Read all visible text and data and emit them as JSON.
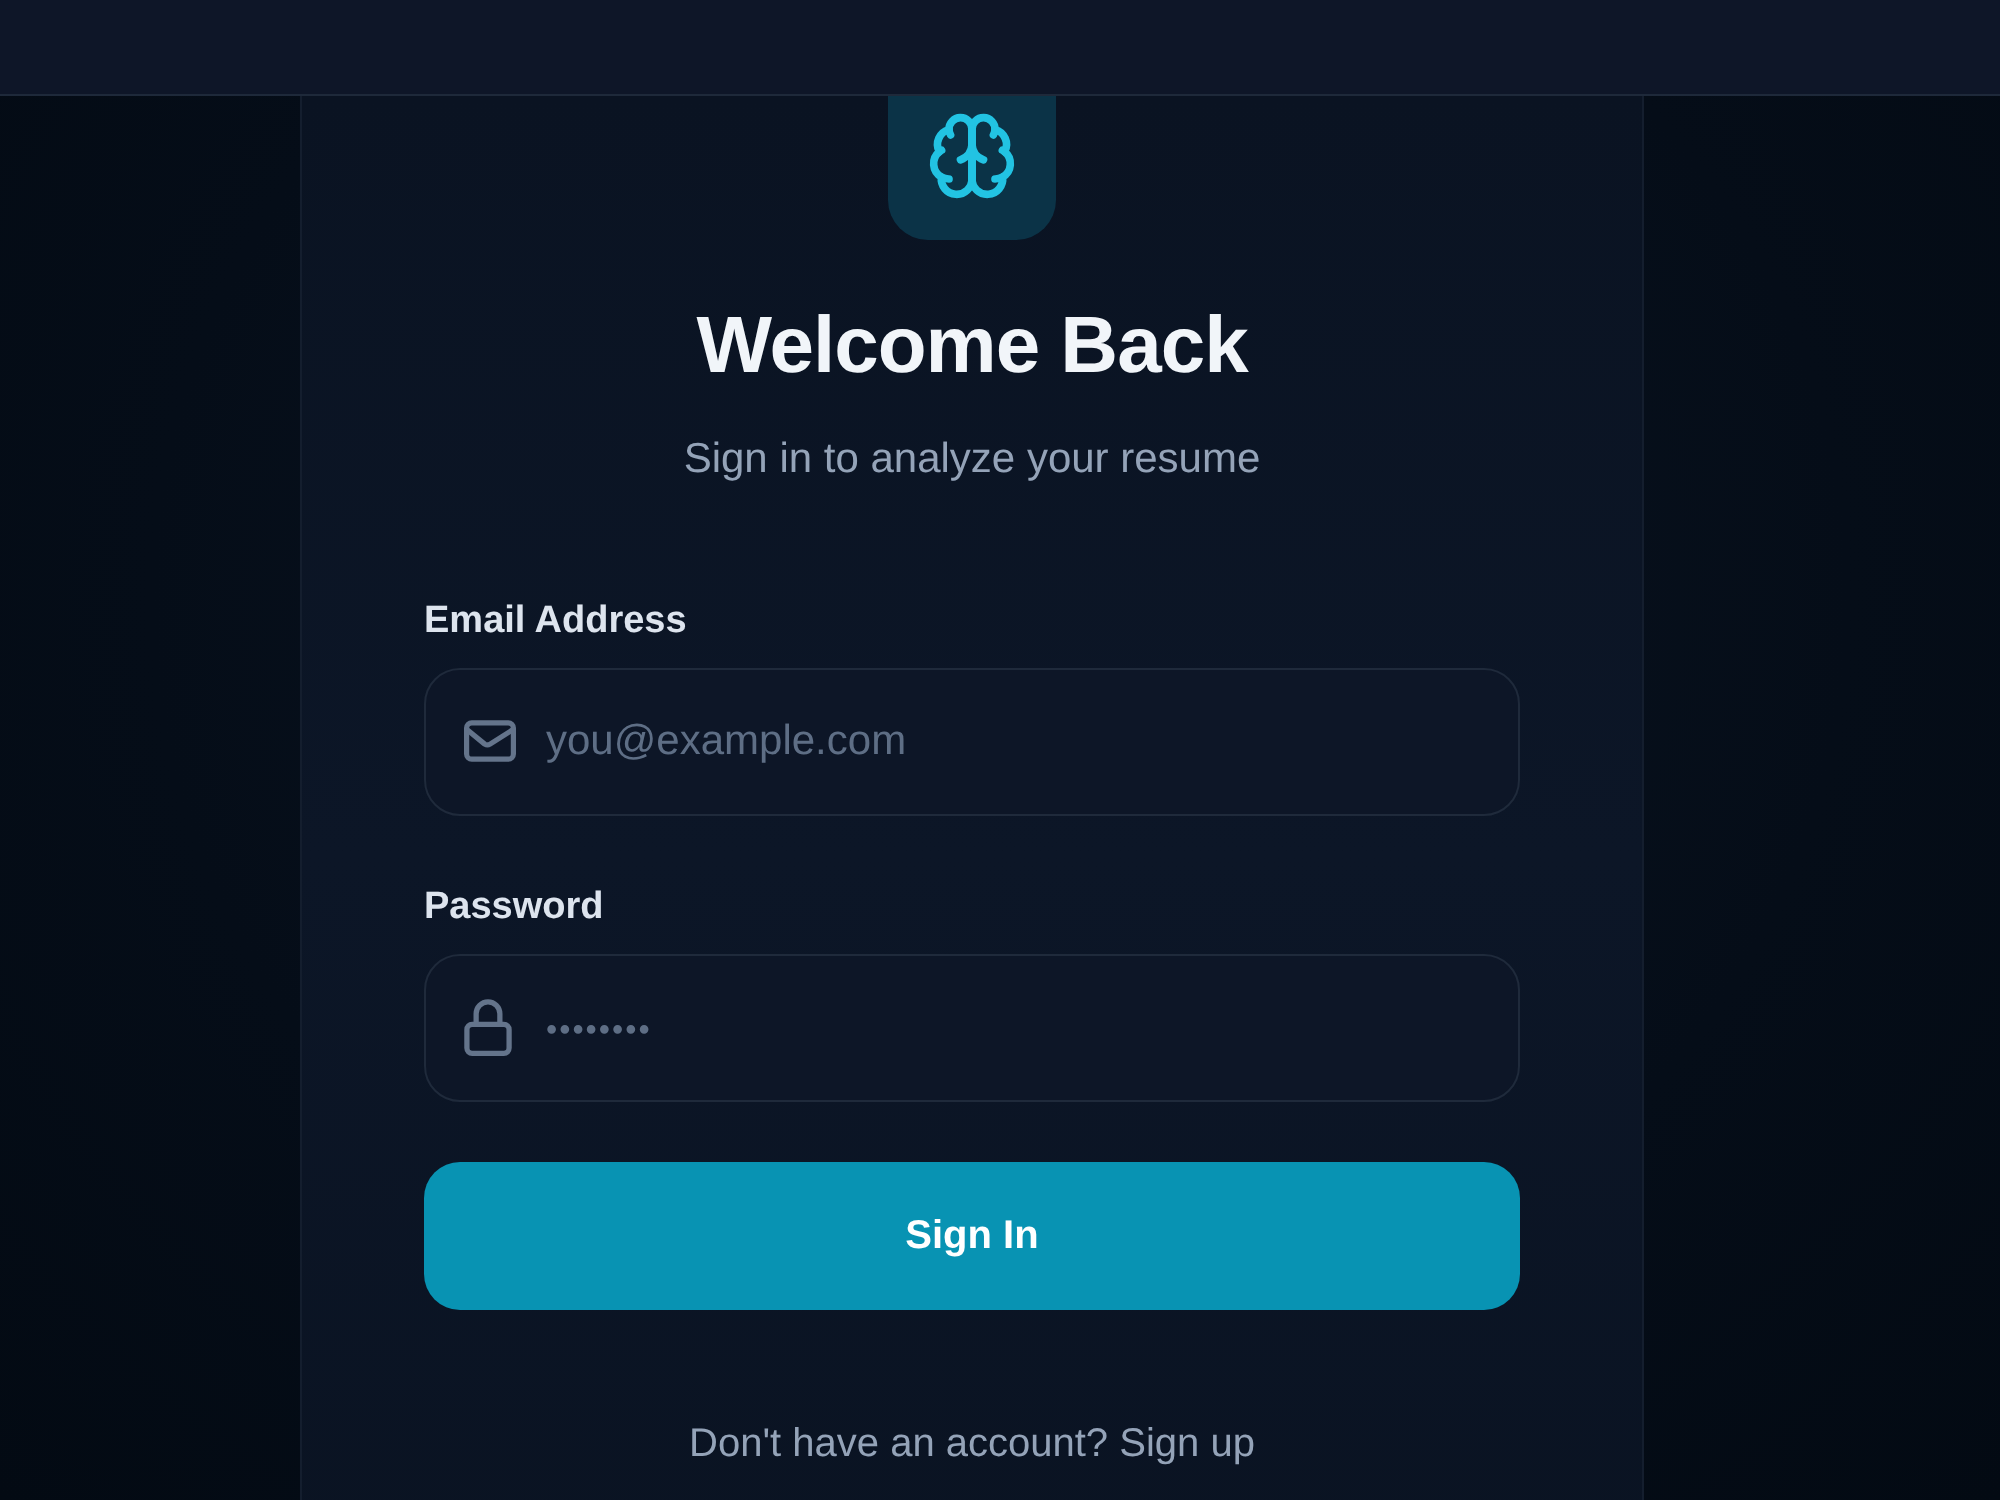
{
  "title": "Welcome Back",
  "subtitle": "Sign in to analyze your resume",
  "fields": [
    {
      "kind": "email",
      "label": "Email Address",
      "placeholder": "you@example.com"
    },
    {
      "kind": "password",
      "label": "Password",
      "placeholder": "••••••••"
    }
  ],
  "submit": "Sign In",
  "footer": {
    "text": "Don't have an account?",
    "link": "Sign up"
  }
}
